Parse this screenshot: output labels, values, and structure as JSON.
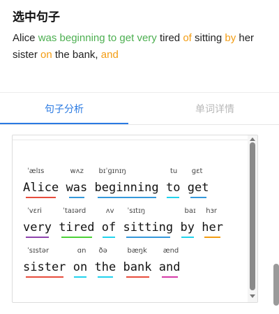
{
  "header": {
    "title": "选中句子",
    "sentence": [
      {
        "text": "Alice ",
        "color": "black"
      },
      {
        "text": "was beginning to get very",
        "color": "green"
      },
      {
        "text": " tired ",
        "color": "black"
      },
      {
        "text": "of",
        "color": "orange"
      },
      {
        "text": " sitting ",
        "color": "black"
      },
      {
        "text": "by",
        "color": "orange"
      },
      {
        "text": " her sister ",
        "color": "black"
      },
      {
        "text": "on",
        "color": "orange"
      },
      {
        "text": " the bank, ",
        "color": "black"
      },
      {
        "text": "and",
        "color": "orange"
      }
    ]
  },
  "tabs": [
    {
      "label": "句子分析",
      "active": true
    },
    {
      "label": "单词详情",
      "active": false
    }
  ],
  "analysis": {
    "words": [
      {
        "word": "Alice",
        "phonetic": "ˈælɪs",
        "underline": "#e74c3c"
      },
      {
        "word": "was",
        "phonetic": "wʌz",
        "underline": "#3498db"
      },
      {
        "word": "beginning",
        "phonetic": "bɪˈɡɪnɪŋ",
        "underline": "#3498db"
      },
      {
        "word": "to",
        "phonetic": "tu",
        "underline": "#22d3ee"
      },
      {
        "word": "get",
        "phonetic": "ɡɛt",
        "underline": "#3498db"
      },
      {
        "word": "very",
        "phonetic": "ˈvɛri",
        "underline": "#8e44ad"
      },
      {
        "word": "tired",
        "phonetic": "ˈtaɪərd",
        "underline": "#4cd137"
      },
      {
        "word": "of",
        "phonetic": "ʌv",
        "underline": "#22d3ee"
      },
      {
        "word": "sitting",
        "phonetic": "ˈsɪtɪŋ",
        "underline": "#3498db"
      },
      {
        "word": "by",
        "phonetic": "baɪ",
        "underline": "#22d3ee"
      },
      {
        "word": "her",
        "phonetic": "hɜr",
        "underline": "#f39c12"
      },
      {
        "word": "sister",
        "phonetic": "ˈsɪstər",
        "underline": "#e74c3c"
      },
      {
        "word": "on",
        "phonetic": "ɑn",
        "underline": "#22d3ee"
      },
      {
        "word": "the",
        "phonetic": "ðə",
        "underline": "#22d3ee"
      },
      {
        "word": "bank",
        "phonetic": "bæŋk",
        "underline": "#e74c3c"
      },
      {
        "word": "and",
        "phonetic": "ænd",
        "underline": "#d63aa8"
      }
    ]
  },
  "colors": {
    "accent": "#2a7ae2",
    "green": "#4caf50",
    "orange": "#f39c12"
  }
}
